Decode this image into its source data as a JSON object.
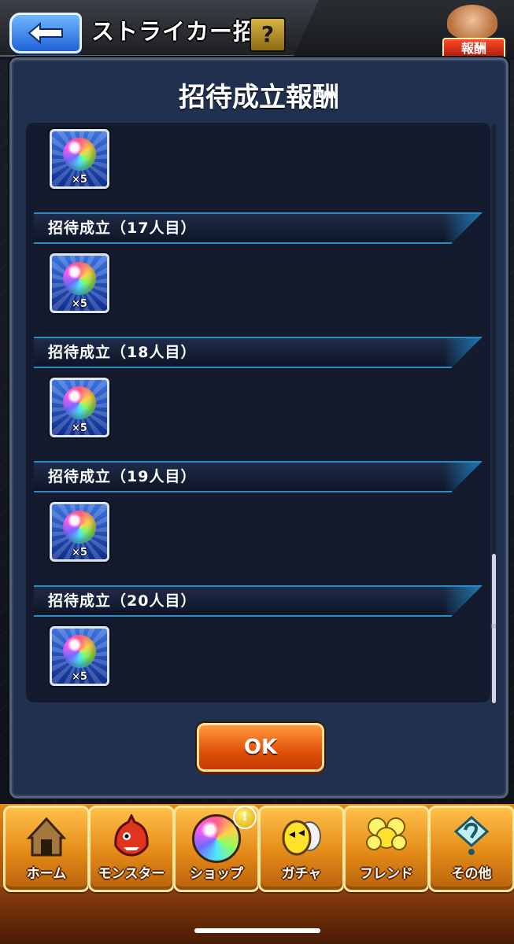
{
  "header": {
    "title": "ストライカー招待",
    "help_label": "?",
    "reward_badge_label": "報酬"
  },
  "modal": {
    "title": "招待成立報酬",
    "top_item": {
      "icon": "rainbow-orb-icon",
      "quantity": "×5"
    },
    "tiers": [
      {
        "label": "招待成立（17人目）",
        "reward": {
          "icon": "rainbow-orb-icon",
          "quantity": "×5"
        }
      },
      {
        "label": "招待成立（18人目）",
        "reward": {
          "icon": "rainbow-orb-icon",
          "quantity": "×5"
        }
      },
      {
        "label": "招待成立（19人目）",
        "reward": {
          "icon": "rainbow-orb-icon",
          "quantity": "×5"
        }
      },
      {
        "label": "招待成立（20人目）",
        "reward": {
          "icon": "rainbow-orb-icon",
          "quantity": "×5"
        }
      }
    ],
    "ok_label": "OK"
  },
  "bottom_nav": {
    "items": [
      {
        "label": "ホーム",
        "icon": "home-icon"
      },
      {
        "label": "モンスター",
        "icon": "monster-icon"
      },
      {
        "label": "ショップ",
        "icon": "shop-orb-icon"
      },
      {
        "label": "ガチャ",
        "icon": "gacha-egg-icon"
      },
      {
        "label": "フレンド",
        "icon": "friend-balloon-icon"
      },
      {
        "label": "その他",
        "icon": "other-icon"
      }
    ],
    "shop_badge": "!"
  },
  "colors": {
    "accent_blue": "#2b8cc4",
    "ok_orange": "#e0500a",
    "nav_orange": "#e48a18"
  }
}
